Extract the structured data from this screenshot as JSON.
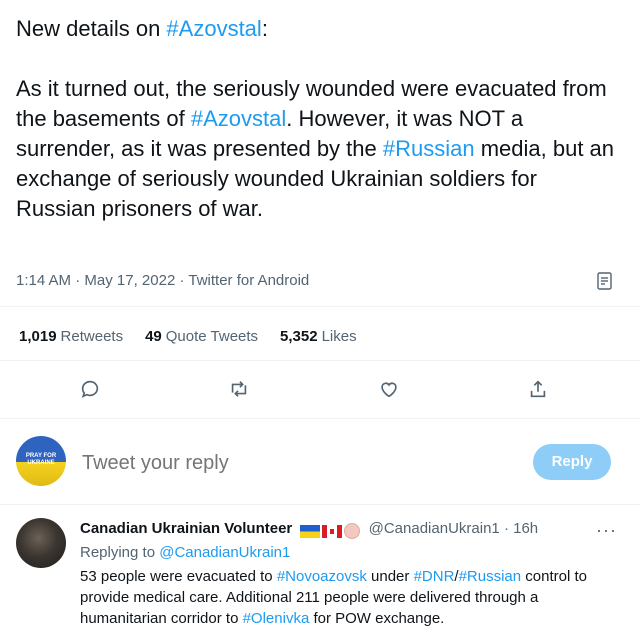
{
  "tweet": {
    "line1_prefix": "New details on ",
    "tag_azovstal": "#Azovstal",
    "line1_suffix": ":",
    "p2_a": "As it turned out, the seriously wounded were evacuated from the basements of ",
    "p2_b": ". However, it was NOT a surrender, as it was presented by the ",
    "tag_russian": "#Russian",
    "p2_c": " media, but an exchange of seriously wounded Ukrainian soldiers for Russian prisoners of war.",
    "time": "1:14 AM",
    "date": "May 17, 2022",
    "source": "Twitter for Android",
    "sep": "·"
  },
  "stats": {
    "retweets_count": "1,019",
    "retweets_label": "Retweets",
    "quotes_count": "49",
    "quotes_label": "Quote Tweets",
    "likes_count": "5,352",
    "likes_label": "Likes"
  },
  "composer": {
    "avatar_text": "PRAY FOR UKRAINE",
    "placeholder": "Tweet your reply",
    "button": "Reply"
  },
  "reply": {
    "name": "Canadian Ukrainian Volunteer",
    "handle": "@CanadianUkrain1",
    "dot": "·",
    "time": "16h",
    "replying_prefix": "Replying to ",
    "replying_handle": "@CanadianUkrain1",
    "t1": "53 people were evacuated to ",
    "tag_novo": "#Novoazovsk",
    "t2": " under ",
    "tag_dnr": "#DNR",
    "t3": "/",
    "tag_russian": "#Russian",
    "t4": " control to provide medical care. Additional 211 people were delivered through a humanitarian corridor to ",
    "tag_olenivka": "#Olenivka",
    "t5": " for POW exchange.",
    "more": "···"
  },
  "colors": {
    "link": "#1d9bf0",
    "secondary": "#536471",
    "reply_button": "#8ecdf8"
  }
}
